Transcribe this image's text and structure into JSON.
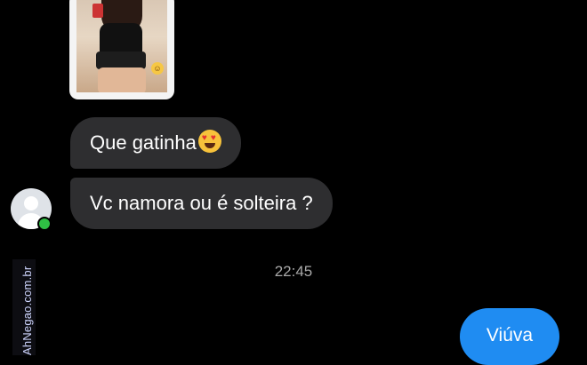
{
  "conversation": {
    "messages_in": [
      {
        "text": "Que gatinha",
        "emoji": "heart-eyes-emoji"
      },
      {
        "text": "Vc namora ou é solteira ?"
      }
    ],
    "timestamp": "22:45",
    "messages_out": [
      {
        "text": "Viúva"
      }
    ]
  },
  "contact": {
    "online": true,
    "online_color": "#2fbf44"
  },
  "watermark": {
    "text": "AhNegao.com.br"
  },
  "colors": {
    "background": "#000000",
    "incoming_bubble": "#2e2e30",
    "outgoing_bubble": "#1f8cf2"
  }
}
